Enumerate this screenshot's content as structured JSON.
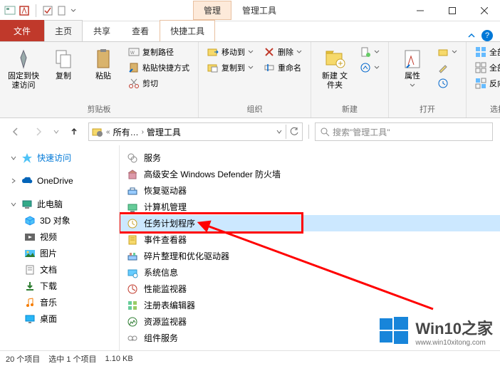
{
  "titlebar": {
    "context_tab": "管理",
    "title": "管理工具"
  },
  "tabs": {
    "file": "文件",
    "home": "主页",
    "share": "共享",
    "view": "查看",
    "tools": "快捷工具"
  },
  "ribbon": {
    "clipboard": {
      "pin": "固定到快\n速访问",
      "copy": "复制",
      "paste": "粘贴",
      "copy_path": "复制路径",
      "paste_shortcut": "粘贴快捷方式",
      "cut": "剪切",
      "group": "剪贴板"
    },
    "organize": {
      "move_to": "移动到",
      "copy_to": "复制到",
      "delete": "删除",
      "rename": "重命名",
      "group": "组织"
    },
    "new": {
      "new_folder": "新建\n文件夹",
      "group": "新建"
    },
    "open": {
      "properties": "属性",
      "group": "打开"
    },
    "select": {
      "select_all": "全部选择",
      "select_none": "全部取消",
      "invert": "反向选择",
      "group": "选择"
    }
  },
  "address": {
    "crumb_all": "所有…",
    "crumb_current": "管理工具"
  },
  "search": {
    "placeholder": "搜索\"管理工具\""
  },
  "nav": {
    "quick_access": "快速访问",
    "onedrive": "OneDrive",
    "this_pc": "此电脑",
    "objects3d": "3D 对象",
    "videos": "视频",
    "pictures": "图片",
    "documents": "文档",
    "downloads": "下载",
    "music": "音乐",
    "desktop": "桌面"
  },
  "items": [
    "服务",
    "高级安全 Windows Defender 防火墙",
    "恢复驱动器",
    "计算机管理",
    "任务计划程序",
    "事件查看器",
    "碎片整理和优化驱动器",
    "系统信息",
    "性能监视器",
    "注册表编辑器",
    "资源监视器",
    "组件服务"
  ],
  "selected_index": 4,
  "status": {
    "count": "20 个项目",
    "selection": "选中 1 个项目",
    "size": "1.10 KB"
  },
  "watermark": {
    "title": "Win10之家",
    "url": "www.win10xitong.com"
  }
}
